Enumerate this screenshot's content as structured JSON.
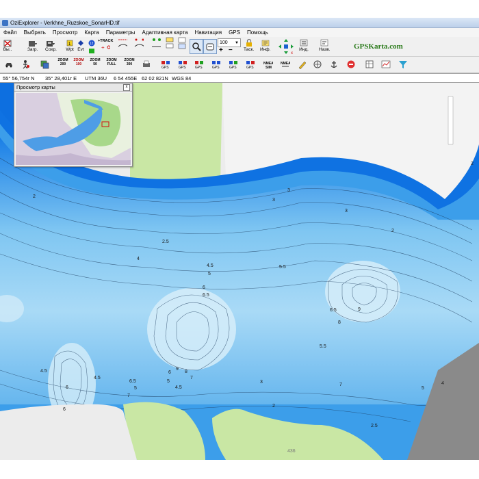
{
  "window": {
    "title": "OziExplorer - Verkhne_Ruzskoe_SonarHD.tif"
  },
  "menu": [
    "Файл",
    "Выбрать",
    "Просмотр",
    "Карта",
    "Параметры",
    "Адаптивная карта",
    "Навигация",
    "GPS",
    "Помощь"
  ],
  "toolbar": {
    "exit_label": "Вы..",
    "load_label": "Загр.",
    "save_label": "Сохр.",
    "wpt_label": "Wpt",
    "evt_label": "Evt",
    "track_label": "+TRACK",
    "zoom_value": "100",
    "task_label": "Таск.",
    "info_label": "Инф.",
    "ind_label": "Инд.",
    "names_label": "Назв.",
    "brand": "GPSKarta.com"
  },
  "zoom_buttons": [
    {
      "top": "ZOOM",
      "bottom": "200"
    },
    {
      "top": "ZOOM",
      "bottom": "100"
    },
    {
      "top": "ZOOM",
      "bottom": "50"
    },
    {
      "top": "ZOOM",
      "bottom": "FULL"
    },
    {
      "top": "ZOOM",
      "bottom": "300"
    }
  ],
  "status": {
    "lat": "55° 56,754г N",
    "lon": "35° 28,401г E",
    "utm": "UTM  36U",
    "easting": "6 54 455E",
    "northing": "62 02 821N",
    "datum": "WGS 84"
  },
  "overview": {
    "title": "Просмотр карты",
    "close": "x"
  },
  "map": {
    "colors": {
      "water_deep": "#0d6fe0",
      "water_mid": "#4fb0ee",
      "water_shallow": "#cfe8f7",
      "land": "#ececec",
      "park": "#c9e7a4",
      "road": "#7a7a7a"
    },
    "depth_labels": [
      "2",
      "3",
      "2",
      "3",
      "2.5",
      "4",
      "3",
      "4.5",
      "5",
      "5.5",
      "6",
      "6.5",
      "9",
      "8",
      "6.5",
      "5.5",
      "7",
      "8",
      "6",
      "9",
      "4.5",
      "5",
      "6.5",
      "5",
      "7",
      "4.5",
      "4.5",
      "3",
      "2",
      "6",
      "2",
      "4",
      "5",
      "7",
      "6",
      "2.5"
    ],
    "road_label": "436"
  }
}
